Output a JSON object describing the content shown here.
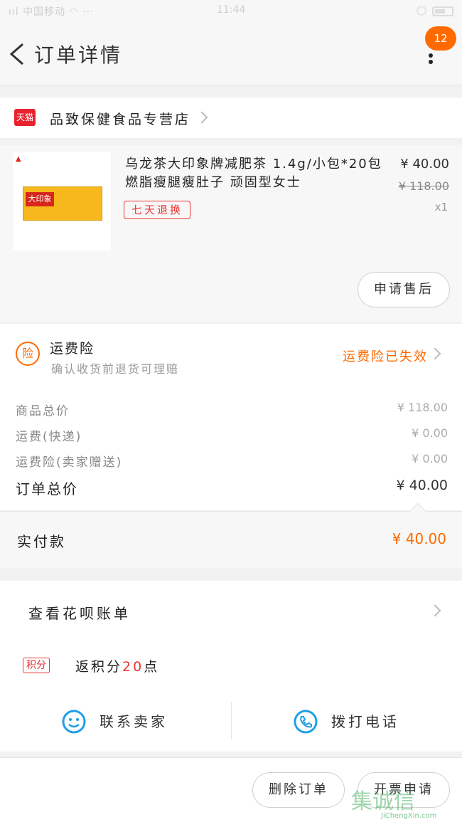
{
  "status_bar": {
    "carrier": "ııl 中国移动 ◠ ···",
    "time": "11:44"
  },
  "header": {
    "title": "订单详情",
    "badge_count": "12"
  },
  "store": {
    "logo_text": "天猫",
    "name": "品致保健食品专营店"
  },
  "product": {
    "brand_text": "大印象",
    "title": "乌龙茶大印象牌减肥茶 1.4g/小包*20包燃脂瘦腿瘦肚子 顽固型女士",
    "return_policy": "七天退换",
    "price": "¥ 40.00",
    "original_price": "¥ 118.00",
    "quantity": "x1",
    "after_sale_button": "申请售后"
  },
  "insurance": {
    "icon_text": "险",
    "title": "运费险",
    "subtitle": "确认收货前退货可理赔",
    "status": "运费险已失效"
  },
  "summary": {
    "rows": [
      {
        "label": "商品总价",
        "value": "¥ 118.00"
      },
      {
        "label": "运费(快递)",
        "value": "¥ 0.00"
      },
      {
        "label": "运费险(卖家赠送)",
        "value": "¥ 0.00"
      }
    ],
    "total_label": "订单总价",
    "total_value": "¥ 40.00"
  },
  "paid": {
    "label": "实付款",
    "amount": "¥ 40.00"
  },
  "huabei": {
    "label": "查看花呗账单"
  },
  "points": {
    "tag": "积分",
    "prefix": "返积分",
    "count": "20",
    "suffix": "点"
  },
  "contact": {
    "seller_label": "联系卖家",
    "phone_label": "拨打电话"
  },
  "footer": {
    "delete_button": "删除订单",
    "invoice_button": "开票申请"
  },
  "watermark": {
    "text": "集诚信",
    "url_text": "JiChengXin.com"
  },
  "colors": {
    "accent": "#ff6a00",
    "red": "#e33333",
    "blue": "#1e9fe6"
  }
}
